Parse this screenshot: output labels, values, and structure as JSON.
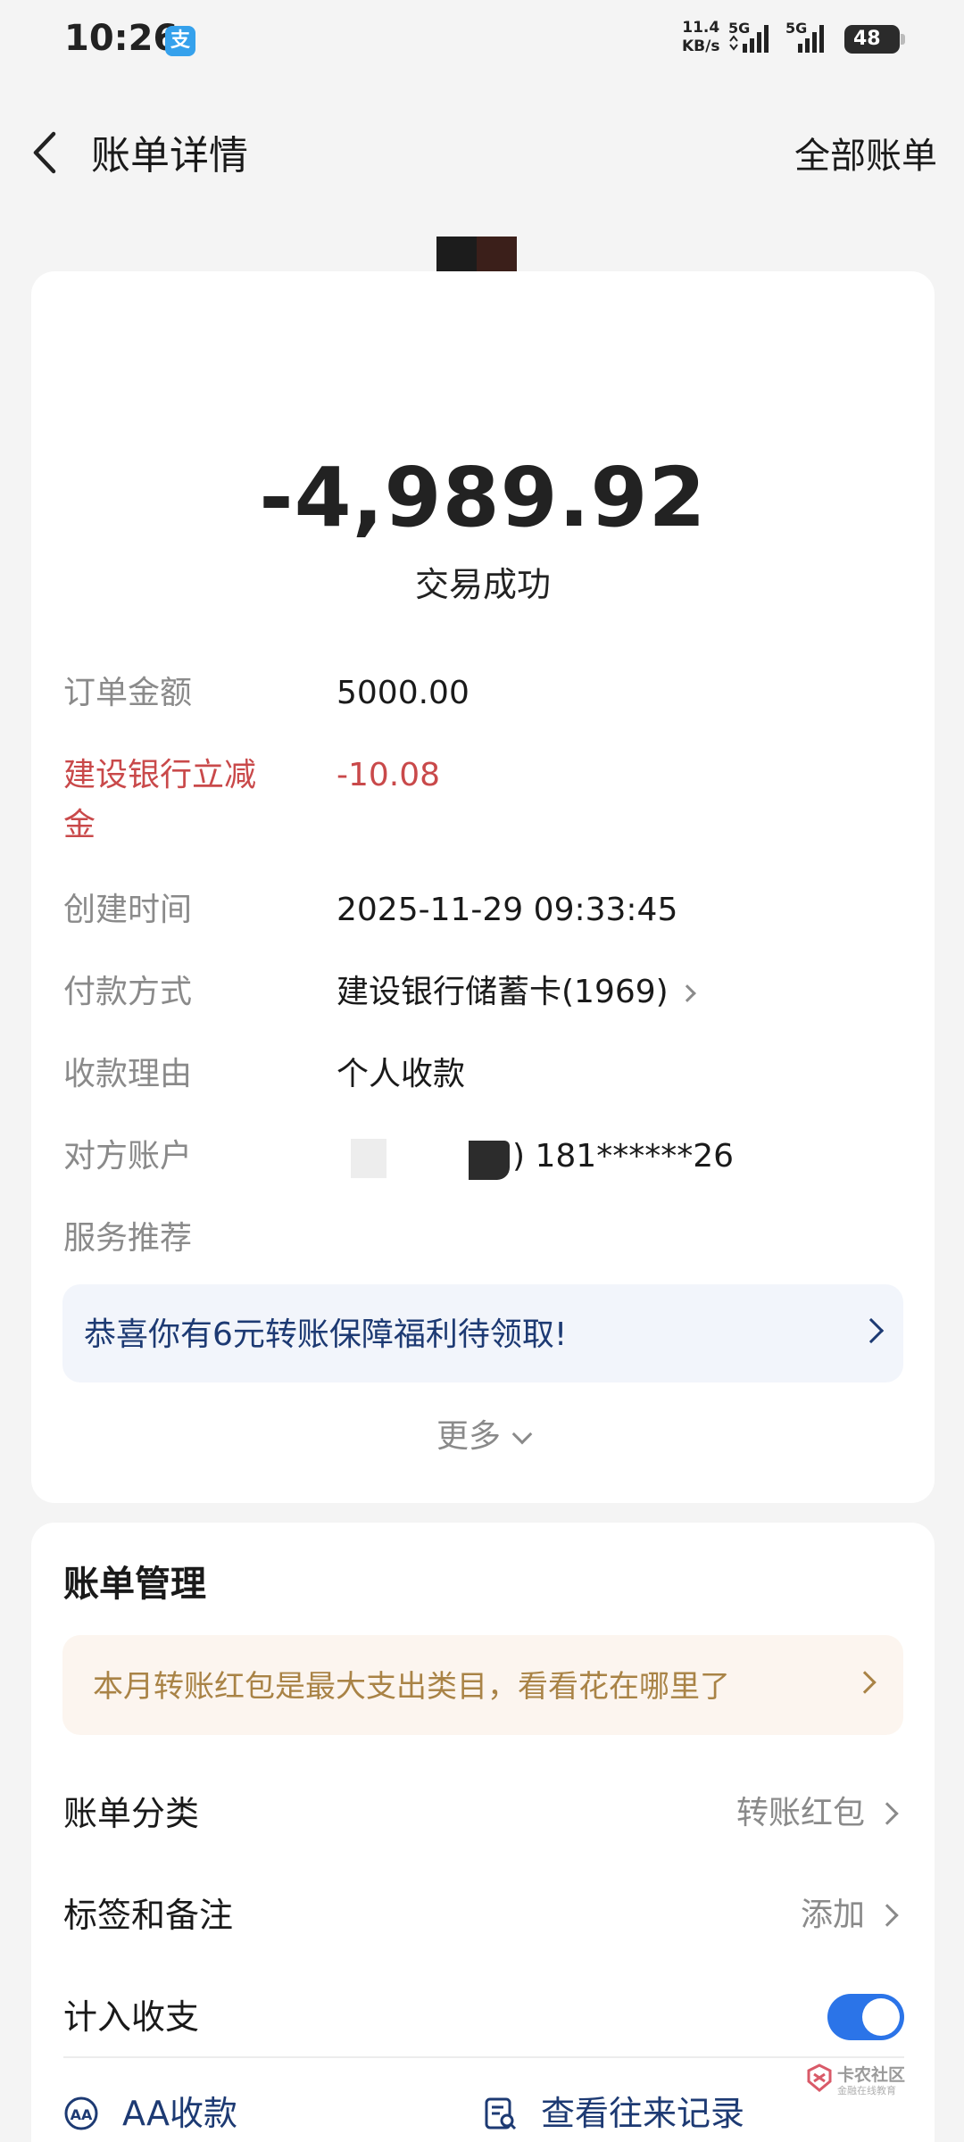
{
  "status_bar": {
    "time": "10:26",
    "app_badge": "支",
    "net_speed_value": "11.4",
    "net_speed_unit": "KB/s",
    "sim1_label": "5G",
    "sim2_label": "5G",
    "battery": "48"
  },
  "header": {
    "title": "账单详情",
    "right_link": "全部账单"
  },
  "transaction": {
    "amount": "-4,989.92",
    "status": "交易成功"
  },
  "details": [
    {
      "label": "订单金额",
      "value": "5000.00"
    },
    {
      "label": "建设银行立减金",
      "value": "-10.08"
    },
    {
      "label": "创建时间",
      "value": "2025-11-29 09:33:45"
    },
    {
      "label": "付款方式",
      "value": "建设银行储蓄卡(1969)"
    },
    {
      "label": "收款理由",
      "value": "个人收款"
    },
    {
      "label": "对方账户",
      "value": ") 181******26"
    },
    {
      "label": "服务推荐",
      "value": ""
    }
  ],
  "promo": {
    "text": "恭喜你有6元转账保障福利待领取!"
  },
  "more_label": "更多",
  "management": {
    "title": "账单管理",
    "insight": "本月转账红包是最大支出类目，看看花在哪里了",
    "category_label": "账单分类",
    "category_value": "转账红包",
    "tags_label": "标签和备注",
    "tags_value": "添加",
    "include_label": "计入收支",
    "include_enabled": true,
    "aa_label": "AA收款",
    "history_label": "查看往来记录"
  },
  "colors": {
    "accent_blue": "#2b74e8",
    "discount_red": "#c9494a",
    "promo_text": "#1d3a73",
    "insight_text": "#a98346"
  },
  "watermark": {
    "main": "卡农社区",
    "sub": "金融在线教育"
  }
}
